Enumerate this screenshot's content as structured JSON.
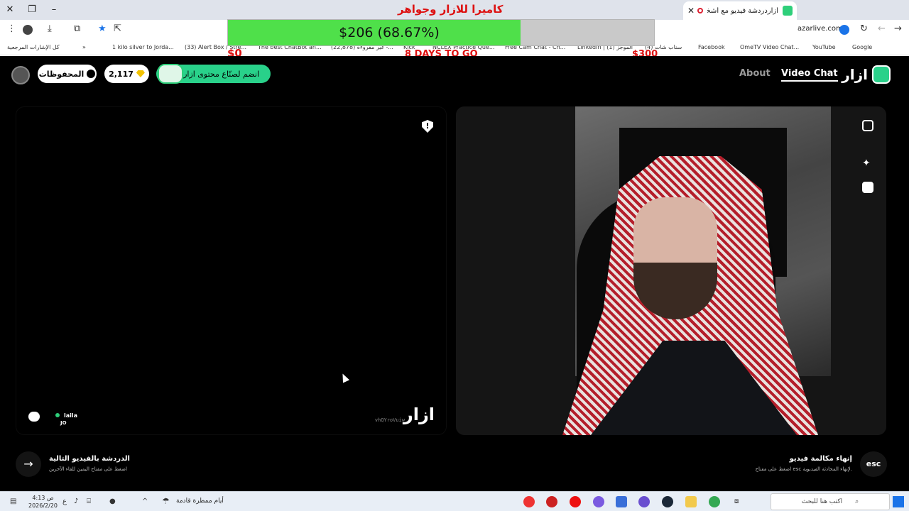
{
  "browser": {
    "tab_title": "أزاردردشة فيديو مع أشخاص",
    "url": "azarlive.com",
    "bookmarks": [
      "Google",
      "YouTube",
      "OmeTV Video Chat...",
      "Facebook",
      "(4) سناب شات",
      "LinkedIn | (1) الموجز",
      "Free Cam Chat - Ch...",
      "NCLEX Practice Que...",
      "Kick",
      "(22,878) غير مقروءة -...",
      "The best ChatBot an...",
      "(33) Alert Box / Stre...",
      "1 kilo silver to Jorda...",
      "كل الإشارات المرجعية"
    ]
  },
  "overlay": {
    "title": "كاميرا للازار وجواهر",
    "progress_text": "$206 (68.67%)",
    "progress_fraction": 0.6867,
    "left_amount": "$0",
    "right_amount": "$300",
    "deadline": "8 DAYS TO GO"
  },
  "header": {
    "logo_text": "ازار",
    "nav_video_chat": "Video Chat",
    "nav_about": "About",
    "creator_cta": "انضم لصنّاع محتوى ازار",
    "gems_count": "2,117",
    "saved_label": "المحفوظات"
  },
  "left_panel": {
    "user_name": "laila",
    "user_country": "JO",
    "watermark_logo": "ازار",
    "watermark_id": "vhQYroVuiw"
  },
  "bottom": {
    "next_title": "الدردشة بالفيديو التالية",
    "next_sub": "اضغط على مفتاح اليمين للقاء الآخرين",
    "end_title": "إنهاء مكالمة فيديو",
    "end_sub": "اضغط على مفتاح esc لإنهاء المحادثة الفيديوية.",
    "esc_label": "esc"
  },
  "taskbar": {
    "time": "4:13 ص",
    "date": "2026/2/20",
    "lang": "ع",
    "weather": "أيام ممطرة قادمة",
    "search_placeholder": "اكتب هنا للبحث"
  },
  "colors": {
    "brand_green": "#29d18a",
    "progress_green": "#4fe04a",
    "overlay_red": "#d11111"
  }
}
